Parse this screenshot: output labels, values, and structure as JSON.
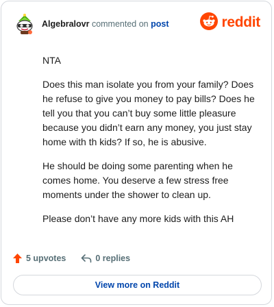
{
  "comment": {
    "username": "Algebralovr",
    "action_text": " commented on ",
    "post_link": "post",
    "avatar_icon": "snoo-avatar-icon",
    "paragraphs": [
      "NTA",
      "Does this man isolate you from your family? Does he refuse to give you money to pay bills? Does he tell you that you can’t buy some little pleasure because you didn’t earn any money, you just stay home with th kids? If so, he is abusive.",
      "He should be doing some parenting when he comes home. You deserve a few stress free moments under the shower to clean up.",
      "Please don’t have any more kids with this AH"
    ]
  },
  "brand": {
    "word": "reddit",
    "icon": "reddit-logo-icon",
    "color": "#ff4500"
  },
  "stats": {
    "upvotes": "5 upvotes",
    "upvote_icon": "upvote-arrow-icon",
    "upvote_color": "#ff4500",
    "replies": "0 replies",
    "reply_icon": "reply-arrow-icon"
  },
  "cta": {
    "label": "View more on Reddit"
  }
}
